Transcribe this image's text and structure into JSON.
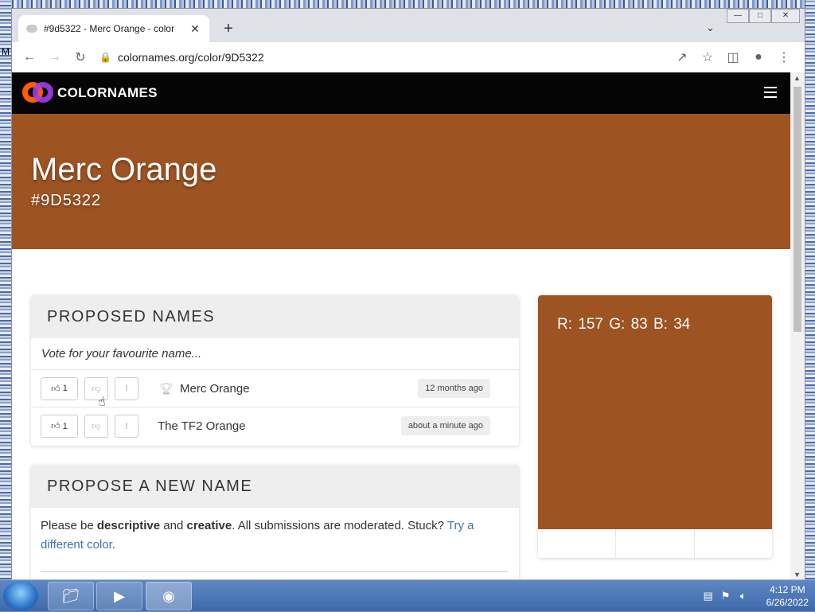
{
  "desktop": {
    "left_letter": "M"
  },
  "browser": {
    "tab_title": "#9d5322 - Merc Orange - color",
    "tab_close": "✕",
    "new_tab": "+",
    "url": "colornames.org/color/9D5322"
  },
  "site": {
    "brand": "COLORNAMES",
    "color_name": "Merc Orange",
    "color_hex": "#9D5322",
    "swatch_color": "#9d5322",
    "rgb": "R: 157   G: 83   B: 34"
  },
  "proposed": {
    "heading": "PROPOSED NAMES",
    "hint": "Vote for your favourite name...",
    "flag_label": "!",
    "names": [
      {
        "upvotes": "1",
        "name": "Merc Orange",
        "time": "12 months ago",
        "has_trophy": true
      },
      {
        "upvotes": "1",
        "name": "The TF2 Orange",
        "time": "about a minute ago",
        "has_trophy": false
      }
    ]
  },
  "propose": {
    "heading": "PROPOSE A NEW NAME",
    "text_1": "Please be ",
    "bold_1": "descriptive",
    "text_2": " and ",
    "bold_2": "creative",
    "text_3": ". All submissions are moderated. Stuck? ",
    "link": "Try a different color",
    "text_4": "."
  },
  "taskbar": {
    "time": "4:12 PM",
    "date": "6/26/2022"
  },
  "colors": {
    "accent_link": "#3b6fb6",
    "nav_bg": "#050505"
  }
}
